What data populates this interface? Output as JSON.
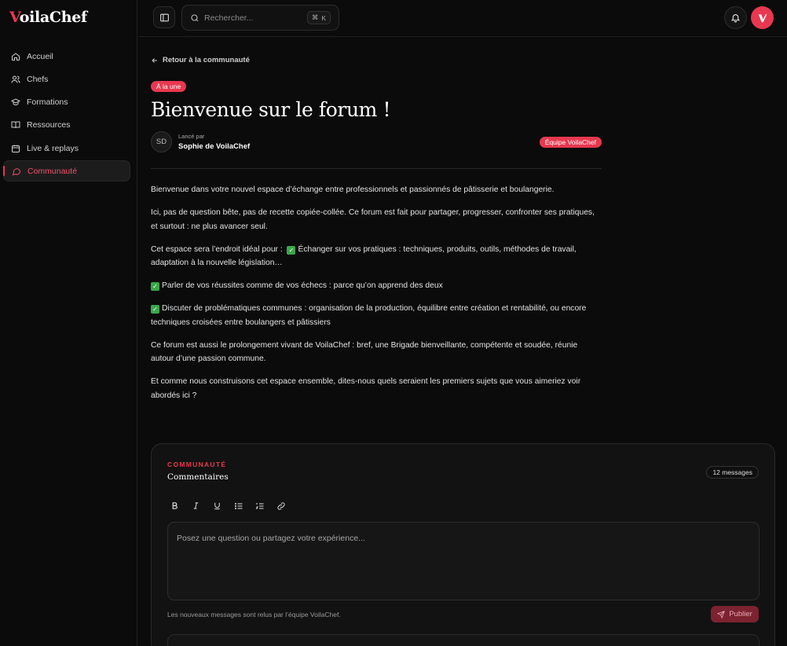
{
  "app": {
    "logo_prefix": "V",
    "logo_rest": "oilaChef"
  },
  "sidebar": {
    "items": [
      {
        "label": "Accueil",
        "icon": "home-icon",
        "active": false
      },
      {
        "label": "Chefs",
        "icon": "users-icon",
        "active": false
      },
      {
        "label": "Formations",
        "icon": "graduation-cap-icon",
        "active": false
      },
      {
        "label": "Ressources",
        "icon": "book-icon",
        "active": false
      },
      {
        "label": "Live & replays",
        "icon": "calendar-icon",
        "active": false
      },
      {
        "label": "Communauté",
        "icon": "chat-bubble-icon",
        "active": true
      }
    ]
  },
  "header": {
    "search_placeholder": "Rechercher...",
    "search_shortcut_symbol": "⌘",
    "search_shortcut_key": "K"
  },
  "post": {
    "back_label": "Retour à la communauté",
    "tag": "À la une",
    "title": "Bienvenue sur le forum !",
    "author_initials": "SD",
    "author_caption": "Lancé par",
    "author_name": "Sophie de VoilaChef",
    "team_badge": "Équipe VoilaChef",
    "paragraphs": [
      "Bienvenue dans votre nouvel espace d’échange entre professionnels et passionnés de pâtisserie et boulangerie.",
      "Ici, pas de question bête, pas de recette copiée-collée. Ce forum est fait pour partager, progresser, confronter ses pratiques, et surtout : ne plus avancer seul.",
      "Cet espace sera l’endroit idéal pour :",
      "Échanger sur vos pratiques : techniques, produits, outils, méthodes de travail, adaptation à la nouvelle législation…",
      "Parler de vos réussites comme de vos échecs : parce qu’on apprend des deux",
      "Discuter de problématiques communes : organisation de la production, équilibre entre création et rentabilité, ou encore techniques croisées entre boulangers et pâtissiers",
      "Ce forum est aussi le prolongement vivant de VoilaChef : bref, une Brigade bienveillante, compétente et soudée, réunie autour d’une passion commune.",
      "Et comme nous construisons cet espace ensemble, dites-nous quels seraient les premiers sujets que vous aimeriez voir abordés ici ?"
    ]
  },
  "comments": {
    "eyebrow": "COMMUNAUTÉ",
    "title": "Commentaires",
    "count_label": "12 messages",
    "editor_placeholder": "Posez une question ou partagez votre expérience...",
    "moderation_note": "Les nouveaux messages sont relus par l’équipe VoilaChef.",
    "publish_label": "Publier"
  },
  "colors": {
    "accent": "#e8384f",
    "background": "#0b0b0b",
    "card": "#121212"
  }
}
